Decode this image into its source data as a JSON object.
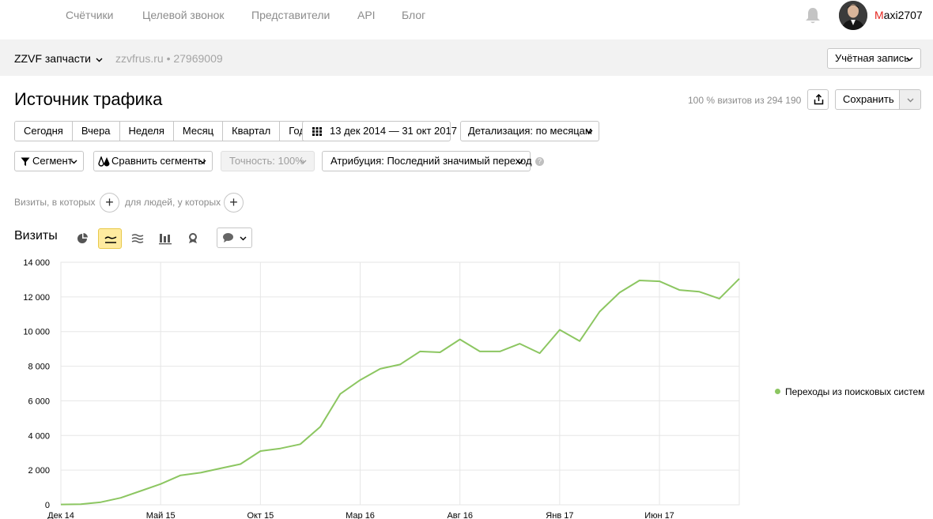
{
  "nav": {
    "links": [
      "Счётчики",
      "Целевой звонок",
      "Представители",
      "API",
      "Блог"
    ],
    "user_first": "M",
    "user_rest": "axi2707"
  },
  "counter": {
    "name": "ZZVF запчасти",
    "site": "zzvfrus.ru • 27969009",
    "account_label": "Учётная запись"
  },
  "report": {
    "title": "Источник трафика",
    "visits_info": "100 % визитов из 294 190",
    "save_label": "Сохранить"
  },
  "periods": [
    "Сегодня",
    "Вчера",
    "Неделя",
    "Месяц",
    "Квартал",
    "Год"
  ],
  "date_range": "13 дек 2014 — 31 окт 2017",
  "detail_label": "Детализация: по месяцам",
  "segment_label": "Сегмент",
  "compare_label": "Сравнить сегменты",
  "accuracy_label": "Точность: 100%",
  "attribution_label": "Атрибуция: Последний значимый переход",
  "filter": {
    "visits_where": "Визиты, в которых",
    "people_where": "для людей, у которых"
  },
  "colors": {
    "series": "#8cc661",
    "grid": "#e6e6e6",
    "active": "#ffeba0"
  },
  "chart_data": {
    "type": "line",
    "title": "Визиты",
    "xlabel": "",
    "ylabel": "",
    "ylim": [
      0,
      14000
    ],
    "ytick_labels": [
      "0",
      "2 000",
      "4 000",
      "6 000",
      "8 000",
      "10 000",
      "12 000",
      "14 000"
    ],
    "ytick_values": [
      0,
      2000,
      4000,
      6000,
      8000,
      10000,
      12000,
      14000
    ],
    "xtick_labels": [
      "Дек 14",
      "Май 15",
      "Окт 15",
      "Мар 16",
      "Авг 16",
      "Янв 17",
      "Июн 17"
    ],
    "xtick_indices": [
      0,
      5,
      10,
      15,
      20,
      25,
      30
    ],
    "grid": true,
    "legend_position": "right",
    "categories": [
      "Дек 14",
      "Янв 15",
      "Фев 15",
      "Мар 15",
      "Апр 15",
      "Май 15",
      "Июн 15",
      "Июл 15",
      "Авг 15",
      "Сен 15",
      "Окт 15",
      "Ноя 15",
      "Дек 15",
      "Янв 16",
      "Фев 16",
      "Мар 16",
      "Апр 16",
      "Май 16",
      "Июн 16",
      "Июл 16",
      "Авг 16",
      "Сен 16",
      "Окт 16",
      "Ноя 16",
      "Дек 16",
      "Янв 17",
      "Фев 17",
      "Мар 17",
      "Апр 17",
      "Май 17",
      "Июн 17",
      "Июл 17",
      "Авг 17",
      "Сен 17",
      "Окт 17"
    ],
    "series": [
      {
        "name": "Переходы из поисковых систем",
        "values": [
          20,
          30,
          150,
          400,
          800,
          1200,
          1700,
          1850,
          2100,
          2350,
          3100,
          3250,
          3500,
          4500,
          6400,
          7200,
          7850,
          8100,
          8850,
          8800,
          9550,
          8850,
          8850,
          9300,
          8750,
          10100,
          9450,
          11150,
          12250,
          12950,
          12900,
          12400,
          12300,
          11900,
          13050
        ]
      }
    ]
  }
}
